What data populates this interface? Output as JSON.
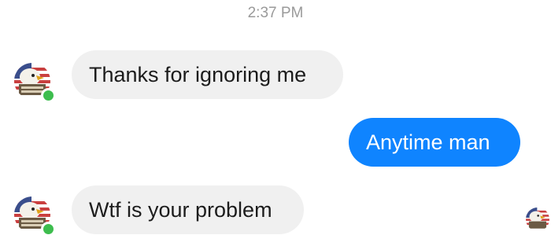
{
  "thread": {
    "timestamp": "2:37 PM"
  },
  "messages": [
    {
      "sender": "contact",
      "text": "Thanks for ignoring me"
    },
    {
      "sender": "me",
      "text": "Anytime man"
    },
    {
      "sender": "contact",
      "text": "Wtf is your problem"
    }
  ],
  "colors": {
    "incoming_bubble": "#f0f0f0",
    "outgoing_bubble": "#0f84ff",
    "online_dot": "#3dbd4e",
    "timestamp_text": "#9a9a9a"
  },
  "icons": {
    "contact_avatar": "eagle-flag-avatar-icon",
    "online_status": "online-status-icon",
    "read_receipt": "read-receipt-avatar-icon"
  }
}
